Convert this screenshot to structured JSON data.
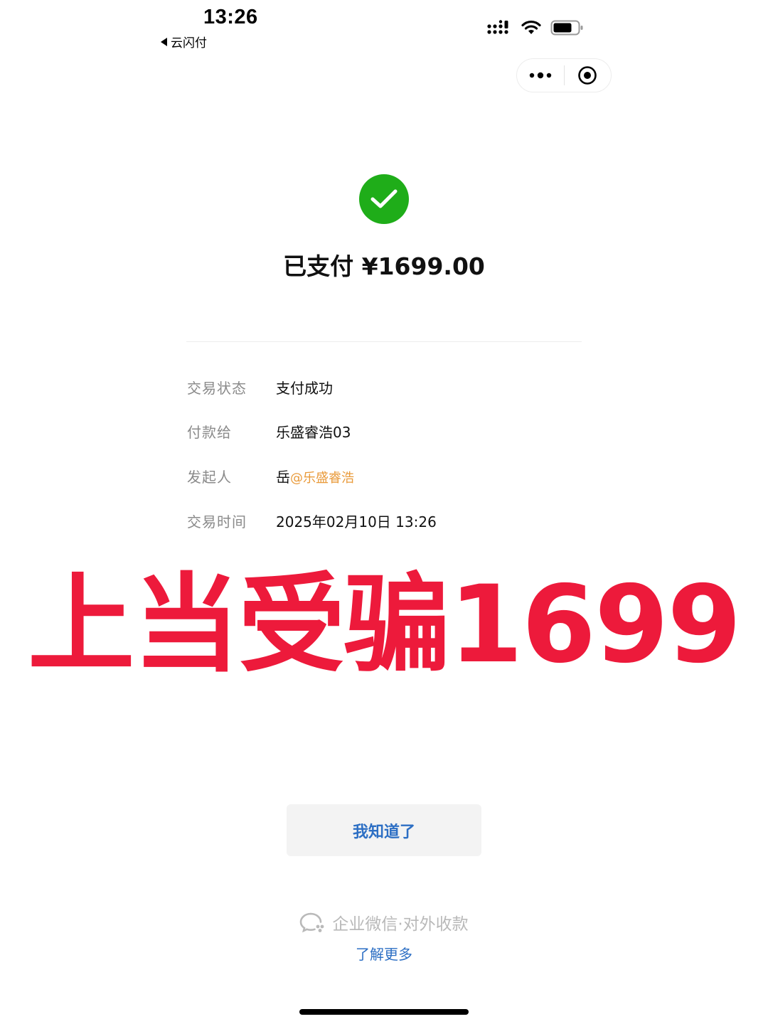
{
  "status_bar": {
    "time": "13:26",
    "back_app": "云闪付"
  },
  "capsule": {
    "menu_icon": "more-dots-icon",
    "close_icon": "target-close-icon"
  },
  "success": {
    "icon": "check-icon",
    "paid_label": "已支付",
    "amount": "¥1699.00"
  },
  "details": {
    "rows": [
      {
        "label": "交易状态",
        "value": "支付成功"
      },
      {
        "label": "付款给",
        "value": "乐盛睿浩03"
      },
      {
        "label": "发起人",
        "value": "岳",
        "tag": "@乐盛睿浩"
      },
      {
        "label": "交易时间",
        "value": "2025年02月10日 13:26"
      }
    ]
  },
  "overlay": {
    "text": "上当受骗1699",
    "color": "#ed1a3b"
  },
  "button": {
    "label": "我知道了",
    "color": "#2d6fc4"
  },
  "footer": {
    "brand_icon": "wecom-logo-icon",
    "brand": "企业微信·对外收款",
    "link": "了解更多"
  },
  "colors": {
    "success": "#1fad19",
    "tag": "#e99a3a",
    "link": "#2d6fc4"
  }
}
